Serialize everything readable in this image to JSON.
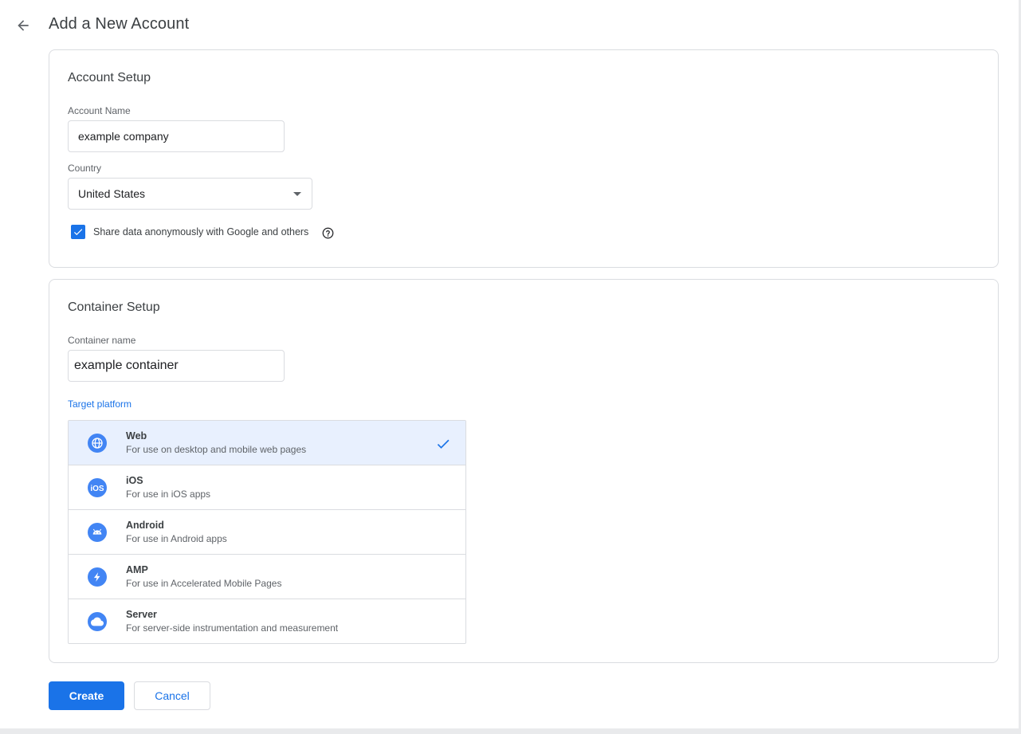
{
  "header": {
    "title": "Add a New Account"
  },
  "account_setup": {
    "title": "Account Setup",
    "account_name_label": "Account Name",
    "account_name_value": "example company",
    "country_label": "Country",
    "country_value": "United States",
    "share_data_label": "Share data anonymously with Google and others",
    "share_data_checked": true
  },
  "container_setup": {
    "title": "Container Setup",
    "container_name_label": "Container name",
    "container_name_value": "example container",
    "target_platform_label": "Target platform",
    "platforms": [
      {
        "name": "Web",
        "description": "For use on desktop and mobile web pages",
        "icon": "globe-icon",
        "selected": true
      },
      {
        "name": "iOS",
        "description": "For use in iOS apps",
        "icon": "ios-icon",
        "selected": false
      },
      {
        "name": "Android",
        "description": "For use in Android apps",
        "icon": "android-icon",
        "selected": false
      },
      {
        "name": "AMP",
        "description": "For use in Accelerated Mobile Pages",
        "icon": "lightning-icon",
        "selected": false
      },
      {
        "name": "Server",
        "description": "For server-side instrumentation and measurement",
        "icon": "cloud-icon",
        "selected": false
      }
    ]
  },
  "actions": {
    "create_label": "Create",
    "cancel_label": "Cancel"
  },
  "colors": {
    "accent": "#1a73e8",
    "platform_icon": "#4285f4",
    "selected_bg": "#e8f0fe",
    "border": "#dadce0"
  }
}
